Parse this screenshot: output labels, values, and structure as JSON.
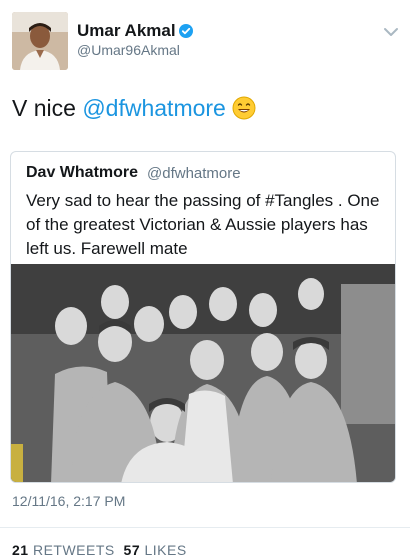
{
  "tweet": {
    "author_name": "Umar Akmal",
    "handle": "@Umar96Akmal",
    "text_prefix": "V nice ",
    "mention": "@dfwhatmore",
    "emoji": "smiling-face-emoji",
    "timestamp": "12/11/16, 2:17 PM"
  },
  "quoted": {
    "author_name": "Dav Whatmore",
    "handle": "@dfwhatmore",
    "text": "Very sad to hear the passing of #Tangles . One of the greatest Victorian & Aussie players has left us. Farewell mate",
    "photo": "black-and-white-team-celebration-photo"
  },
  "stats": {
    "retweets_count": "21",
    "retweets_label": "RETWEETS",
    "likes_count": "57",
    "likes_label": "LIKES"
  },
  "colors": {
    "link": "#1b95e0",
    "verified": "#1da1f2",
    "secondary_text": "#657786"
  },
  "icons": [
    "verified-badge-icon",
    "chevron-down-icon"
  ]
}
